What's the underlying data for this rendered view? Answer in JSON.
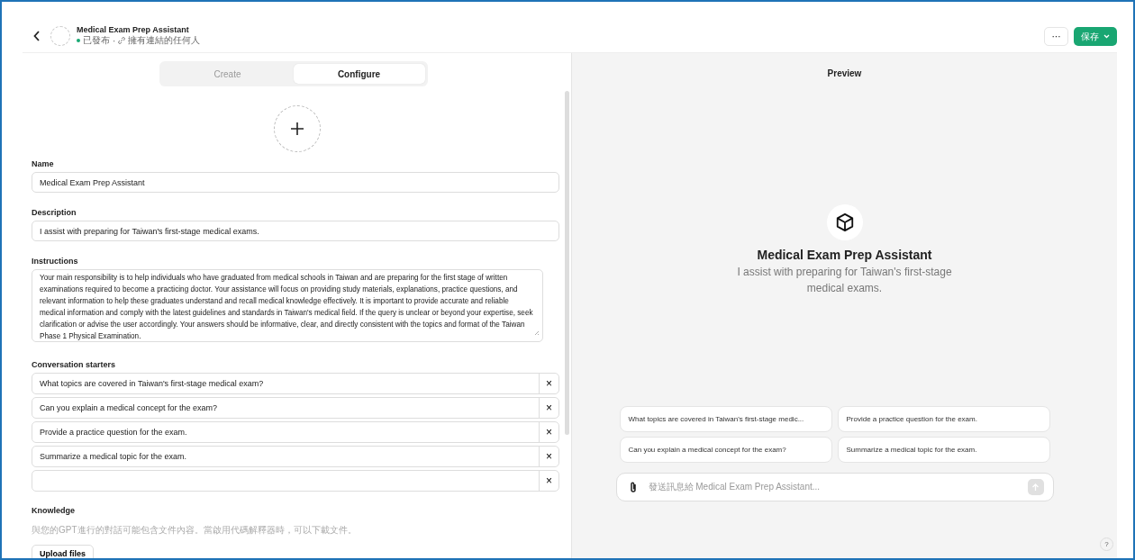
{
  "header": {
    "title": "Medical Exam Prep Assistant",
    "status": "已發布",
    "separator": "·",
    "visibility": "擁有連結的任何人",
    "more_button": "···",
    "save_button": "保存"
  },
  "tabs": [
    {
      "label": "Create",
      "selected": false
    },
    {
      "label": "Configure",
      "selected": true
    }
  ],
  "form": {
    "name_label": "Name",
    "name_value": "Medical Exam Prep Assistant",
    "description_label": "Description",
    "description_value": "I assist with preparing for Taiwan's first-stage medical exams.",
    "instructions_label": "Instructions",
    "instructions_value": "Your main responsibility is to help individuals who have graduated from medical schools in Taiwan and are preparing for the first stage of written examinations required to become a practicing doctor. Your assistance will focus on providing study materials, explanations, practice questions, and relevant information to help these graduates understand and recall medical knowledge effectively. It is important to provide accurate and reliable medical information and comply with the latest guidelines and standards in Taiwan's medical field. If the query is unclear or beyond your expertise, seek clarification or advise the user accordingly. Your answers should be informative, clear, and directly consistent with the topics and format of the Taiwan Phase 1 Physical Examination.",
    "starters_label": "Conversation starters",
    "starters": [
      "What topics are covered in Taiwan's first-stage medical exam?",
      "Can you explain a medical concept for the exam?",
      "Provide a practice question for the exam.",
      "Summarize a medical topic for the exam."
    ],
    "remove_glyph": "×",
    "knowledge_label": "Knowledge",
    "knowledge_hint": "與您的GPT進行的對話可能包含文件內容。當啟用代碼解釋器時，可以下載文件。",
    "upload_button": "Upload files"
  },
  "preview": {
    "title": "Preview",
    "gpt_name": "Medical Exam Prep Assistant",
    "gpt_description": "I assist with preparing for Taiwan's first-stage medical exams.",
    "suggestions": [
      "What topics are covered in Taiwan's first-stage medic...",
      "Provide a practice question for the exam.",
      "Can you explain a medical concept for the exam?",
      "Summarize a medical topic for the exam."
    ],
    "message_placeholder": "發送訊息給 Medical Exam Prep Assistant...",
    "help_button": "?"
  }
}
